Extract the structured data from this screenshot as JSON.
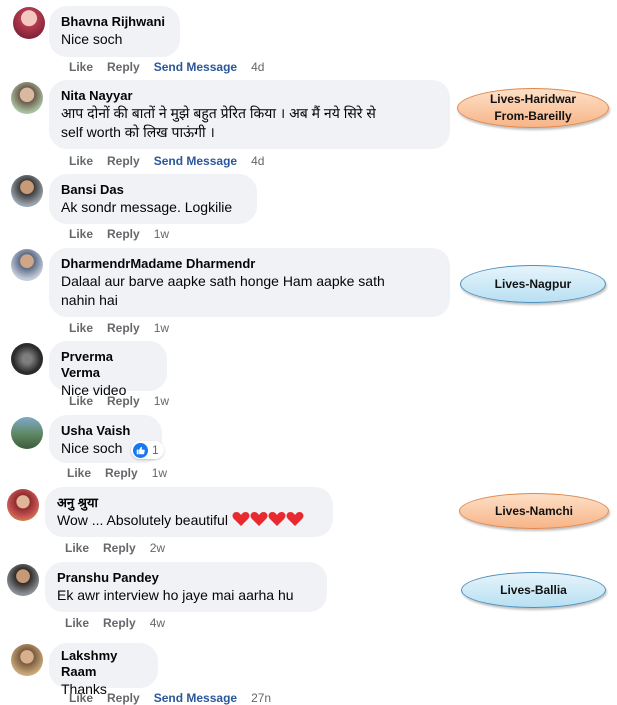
{
  "actions": {
    "like": "Like",
    "reply": "Reply",
    "send_message": "Send Message"
  },
  "comments": [
    {
      "author": "Bhavna Rijhwani",
      "text": "Nice soch",
      "time": "4d"
    },
    {
      "author": "Nita Nayyar",
      "text_line1": "आप दोनों की बातों ने मुझे बहुत प्रेरित किया । अब मैं नये सिरे से",
      "text_line2": "self worth को लिख पाऊंगी ।",
      "time": "4d"
    },
    {
      "author": "Bansi Das",
      "text": "Ak sondr message. Logkilie",
      "time": "1w"
    },
    {
      "author": "DharmendrMadame Dharmendr",
      "text_line1": "Dalaal aur barve aapke sath honge Ham aapke sath",
      "text_line2": "nahin hai",
      "time": "1w"
    },
    {
      "author": "Prverma Verma",
      "text": "Nice video",
      "time": "1w"
    },
    {
      "author": "Usha Vaish",
      "text": "Nice soch",
      "reaction_count": "1",
      "time": "1w"
    },
    {
      "author": "अनु श्रुया",
      "text": "Wow ... Absolutely beautiful",
      "time": "2w"
    },
    {
      "author": "Pranshu Pandey",
      "text": "Ek awr interview ho jaye mai aarha hu",
      "time": "4w"
    },
    {
      "author": "Lakshmy Raam",
      "text": "Thanks",
      "time": "27n"
    }
  ],
  "tags": [
    {
      "line1": "Lives-Haridwar",
      "line2": "From-Bareilly"
    },
    {
      "line1": "Lives-Nagpur"
    },
    {
      "line1": "Lives-Namchi"
    },
    {
      "line1": "Lives-Ballia"
    }
  ],
  "icons": {
    "reaction": "like-reaction-icon",
    "heart": "heart-icon"
  },
  "colors": {
    "bubble": "#f0f2f5",
    "meta": "#65676b",
    "send": "#2b579a",
    "heart": "#e8292f",
    "like_blue": "#1877f2"
  }
}
